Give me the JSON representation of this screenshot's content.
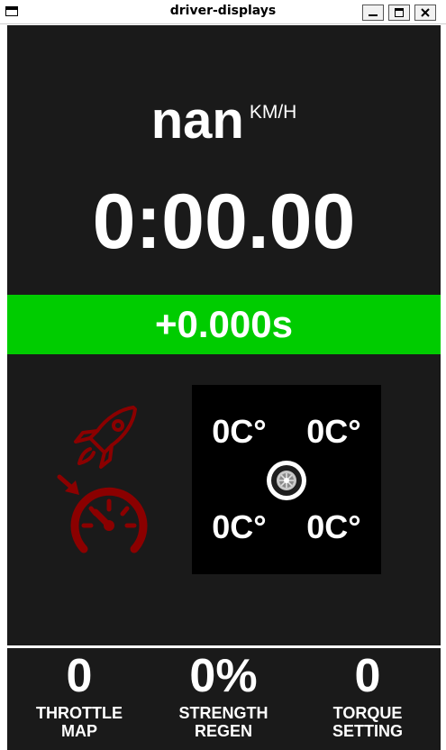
{
  "window": {
    "title": "driver-displays"
  },
  "speed": {
    "value": "nan",
    "unit": "KM/H"
  },
  "lap_time": "0:00.00",
  "delta": {
    "value": "+0.000s",
    "color": "#00cc00"
  },
  "icons": {
    "rocket": "rocket-icon",
    "gauge": "speedometer-icon",
    "tyre": "tyre-icon",
    "accent": "#8b0000"
  },
  "tyres": {
    "front_left": "0C°",
    "front_right": "0C°",
    "rear_left": "0C°",
    "rear_right": "0C°"
  },
  "stats": [
    {
      "value": "0",
      "label_line1": "THROTTLE",
      "label_line2": "MAP"
    },
    {
      "value": "0%",
      "label_line1": "STRENGTH",
      "label_line2": "REGEN"
    },
    {
      "value": "0",
      "label_line1": "TORQUE",
      "label_line2": "SETTING"
    }
  ]
}
